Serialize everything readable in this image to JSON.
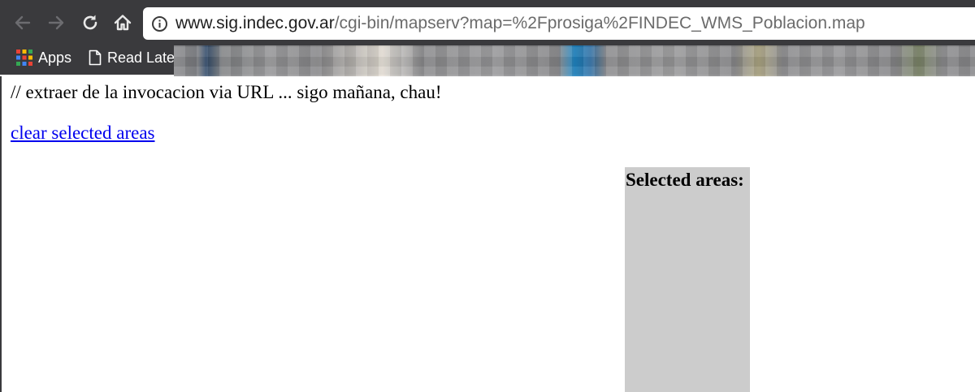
{
  "browser": {
    "url_host": "www.sig.indec.gov.ar",
    "url_path": "/cgi-bin/mapserv?map=%2Fprosiga%2FINDEC_WMS_Poblacion.map",
    "bookmarks": [
      {
        "label": "Apps",
        "icon": "apps-grid-icon"
      },
      {
        "label": "Read Late",
        "icon": "document-icon"
      }
    ]
  },
  "page": {
    "comment": "// extraer de la invocacion via URL ... sigo mañana, chau!",
    "clear_link": "clear selected areas",
    "selected_areas_title": "Selected areas:"
  },
  "colors": {
    "chrome": "#3a3a3d",
    "link": "#0000ee",
    "panel": "#cccccc"
  }
}
